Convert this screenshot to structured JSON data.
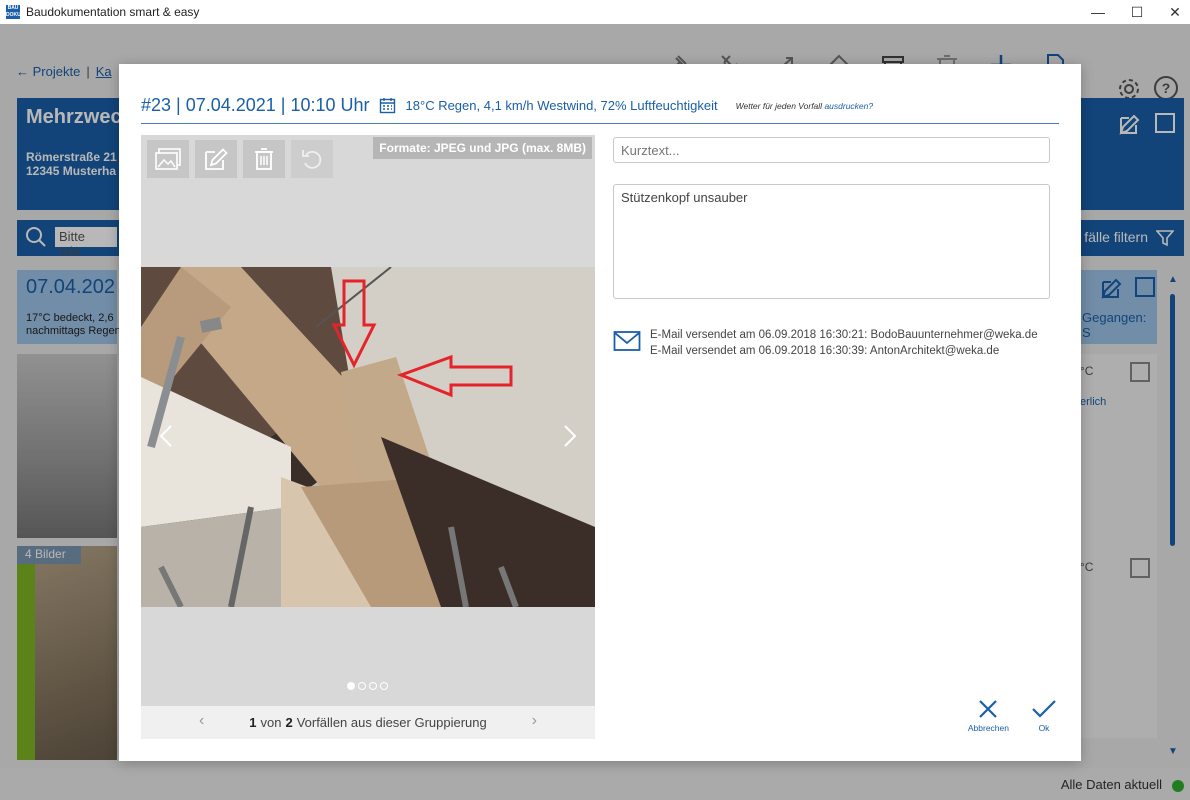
{
  "window": {
    "app_icon_text": "BAU DOKU",
    "title": "Baudokumentation smart & easy",
    "minimize": "—",
    "maximize": "☐",
    "close": "✕"
  },
  "background": {
    "breadcrumb": {
      "back": "← Projekte",
      "sep": "|",
      "next": "Ka"
    },
    "project": {
      "name": "Mehrzwec",
      "street": "Römerstraße 21",
      "city": "12345 Musterha"
    },
    "search": {
      "placeholder": "Bitte min.",
      "filter_label": "fälle filtern"
    },
    "date_card": {
      "date": "07.04.202",
      "weather": "17°C bedeckt, 2,6 nachmittags Regen"
    },
    "right_card": {
      "label": "Gegangen: S"
    },
    "right_col": {
      "t1": "°C",
      "t2": "erlich",
      "t3": "°C"
    },
    "thumb_badge": "4 Bilder",
    "status": "Alle Daten aktuell",
    "status_color": "#2fae2f"
  },
  "dialog": {
    "title": "#23 | 07.04.2021 | 10:10 Uhr",
    "weather": "18°C Regen, 4,1 km/h Westwind, 72% Luftfeuchtigkeit",
    "print_note_prefix": "Wetter für jeden Vorfall ",
    "print_note_link": "ausdrucken?",
    "formats": "Formate: JPEG und JPG (max. 8MB)",
    "pager": {
      "current": "1",
      "von": "von",
      "total": "2",
      "suffix": "Vorfällen aus dieser Gruppierung"
    },
    "image_dots": {
      "count": 4,
      "active": 1
    },
    "kurztext_placeholder": "Kurztext...",
    "langtext_value": "Stützenkopf unsauber",
    "emails": [
      "E-Mail versendet am 06.09.2018 16:30:21: BodoBauunternehmer@weka.de",
      "E-Mail versendet am 06.09.2018 16:30:39: AntonArchitekt@weka.de"
    ],
    "actions": {
      "cancel": "Abbrechen",
      "ok": "Ok"
    }
  },
  "colors": {
    "accent": "#1a5fa8",
    "green": "#7fb624"
  }
}
